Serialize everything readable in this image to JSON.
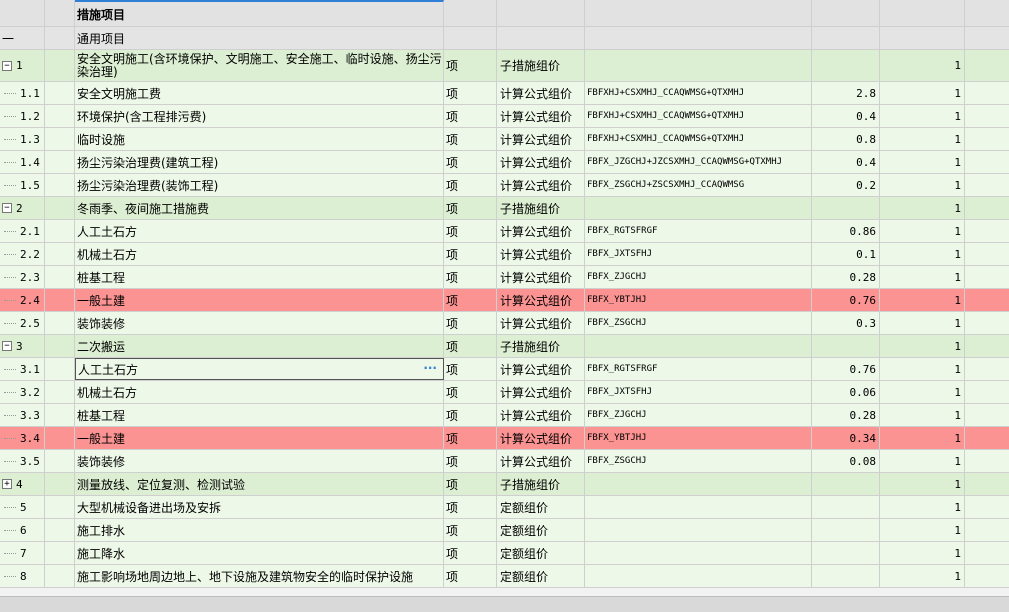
{
  "header": {
    "title": "措施项目"
  },
  "rows": [
    {
      "kind": "sect",
      "no": "一",
      "name": "通用项目",
      "unit": "",
      "type": "",
      "formula": "",
      "rate": "",
      "qty": ""
    },
    {
      "kind": "grp",
      "tall": true,
      "toggle": "−",
      "no": "1",
      "name": "安全文明施工(含环境保护、文明施工、安全施工、临时设施、扬尘污染治理)",
      "unit": "项",
      "type": "子措施组价",
      "formula": "",
      "rate": "",
      "qty": "1"
    },
    {
      "kind": "item",
      "no": "1.1",
      "name": "安全文明施工费",
      "unit": "项",
      "type": "计算公式组价",
      "formula": "FBFXHJ+CSXMHJ_CCAQWMSG+QTXMHJ",
      "rate": "2.8",
      "qty": "1"
    },
    {
      "kind": "item",
      "no": "1.2",
      "name": "环境保护(含工程排污费)",
      "unit": "项",
      "type": "计算公式组价",
      "formula": "FBFXHJ+CSXMHJ_CCAQWMSG+QTXMHJ",
      "rate": "0.4",
      "qty": "1"
    },
    {
      "kind": "item",
      "no": "1.3",
      "name": "临时设施",
      "unit": "项",
      "type": "计算公式组价",
      "formula": "FBFXHJ+CSXMHJ_CCAQWMSG+QTXMHJ",
      "rate": "0.8",
      "qty": "1"
    },
    {
      "kind": "item",
      "no": "1.4",
      "name": "扬尘污染治理费(建筑工程)",
      "unit": "项",
      "type": "计算公式组价",
      "formula": "FBFX_JZGCHJ+JZCSXMHJ_CCAQWMSG+QTXMHJ",
      "rate": "0.4",
      "qty": "1"
    },
    {
      "kind": "item",
      "no": "1.5",
      "name": "扬尘污染治理费(装饰工程)",
      "unit": "项",
      "type": "计算公式组价",
      "formula": "FBFX_ZSGCHJ+ZSCSXMHJ_CCAQWMSG",
      "rate": "0.2",
      "qty": "1"
    },
    {
      "kind": "grp",
      "toggle": "−",
      "no": "2",
      "name": "冬雨季、夜间施工措施费",
      "unit": "项",
      "type": "子措施组价",
      "formula": "",
      "rate": "",
      "qty": "1"
    },
    {
      "kind": "item",
      "no": "2.1",
      "name": "人工土石方",
      "unit": "项",
      "type": "计算公式组价",
      "formula": "FBFX_RGTSFRGF",
      "rate": "0.86",
      "qty": "1"
    },
    {
      "kind": "item",
      "no": "2.2",
      "name": "机械土石方",
      "unit": "项",
      "type": "计算公式组价",
      "formula": "FBFX_JXTSFHJ",
      "rate": "0.1",
      "qty": "1"
    },
    {
      "kind": "item",
      "no": "2.3",
      "name": "桩基工程",
      "unit": "项",
      "type": "计算公式组价",
      "formula": "FBFX_ZJGCHJ",
      "rate": "0.28",
      "qty": "1"
    },
    {
      "kind": "red",
      "no": "2.4",
      "name": "一般土建",
      "unit": "项",
      "type": "计算公式组价",
      "formula": "FBFX_YBTJHJ",
      "rate": "0.76",
      "qty": "1"
    },
    {
      "kind": "item",
      "no": "2.5",
      "name": "装饰装修",
      "unit": "项",
      "type": "计算公式组价",
      "formula": "FBFX_ZSGCHJ",
      "rate": "0.3",
      "qty": "1"
    },
    {
      "kind": "grp",
      "toggle": "−",
      "no": "3",
      "name": "二次搬运",
      "unit": "项",
      "type": "子措施组价",
      "formula": "",
      "rate": "",
      "qty": "1"
    },
    {
      "kind": "item",
      "sel": true,
      "no": "3.1",
      "name": "人工土石方",
      "unit": "项",
      "type": "计算公式组价",
      "formula": "FBFX_RGTSFRGF",
      "rate": "0.76",
      "qty": "1"
    },
    {
      "kind": "item",
      "no": "3.2",
      "name": "机械土石方",
      "unit": "项",
      "type": "计算公式组价",
      "formula": "FBFX_JXTSFHJ",
      "rate": "0.06",
      "qty": "1"
    },
    {
      "kind": "item",
      "no": "3.3",
      "name": "桩基工程",
      "unit": "项",
      "type": "计算公式组价",
      "formula": "FBFX_ZJGCHJ",
      "rate": "0.28",
      "qty": "1"
    },
    {
      "kind": "red",
      "no": "3.4",
      "name": "一般土建",
      "unit": "项",
      "type": "计算公式组价",
      "formula": "FBFX_YBTJHJ",
      "rate": "0.34",
      "qty": "1"
    },
    {
      "kind": "item",
      "no": "3.5",
      "name": "装饰装修",
      "unit": "项",
      "type": "计算公式组价",
      "formula": "FBFX_ZSGCHJ",
      "rate": "0.08",
      "qty": "1"
    },
    {
      "kind": "grp",
      "toggle": "+",
      "no": "4",
      "name": "测量放线、定位复测、检测试验",
      "unit": "项",
      "type": "子措施组价",
      "formula": "",
      "rate": "",
      "qty": "1"
    },
    {
      "kind": "item",
      "no": "5",
      "name": "大型机械设备进出场及安拆",
      "unit": "项",
      "type": "定额组价",
      "formula": "",
      "rate": "",
      "qty": "1"
    },
    {
      "kind": "item",
      "no": "6",
      "name": "施工排水",
      "unit": "项",
      "type": "定额组价",
      "formula": "",
      "rate": "",
      "qty": "1"
    },
    {
      "kind": "item",
      "no": "7",
      "name": "施工降水",
      "unit": "项",
      "type": "定额组价",
      "formula": "",
      "rate": "",
      "qty": "1"
    },
    {
      "kind": "item",
      "no": "8",
      "name": "施工影响场地周边地上、地下设施及建筑物安全的临时保护设施",
      "unit": "项",
      "type": "定额组价",
      "formula": "",
      "rate": "",
      "qty": "1"
    }
  ]
}
